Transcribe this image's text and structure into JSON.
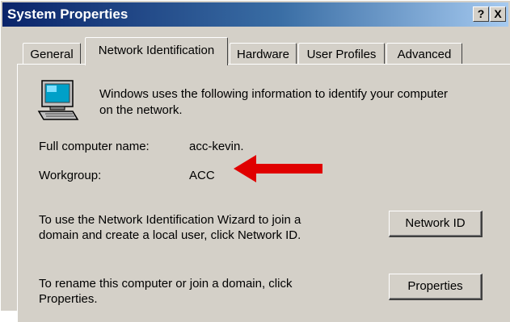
{
  "window": {
    "title": "System Properties",
    "help_label": "?",
    "close_label": "X"
  },
  "tabs": [
    {
      "label": "General",
      "selected": false
    },
    {
      "label": "Network Identification",
      "selected": true
    },
    {
      "label": "Hardware",
      "selected": false
    },
    {
      "label": "User Profiles",
      "selected": false
    },
    {
      "label": "Advanced",
      "selected": false
    }
  ],
  "info": {
    "line1": "Windows uses the following information to identify your computer",
    "line2": "on the network."
  },
  "full_name": {
    "label": "Full computer name:",
    "value": "acc-kevin."
  },
  "workgroup": {
    "label": "Workgroup:",
    "value": "ACC"
  },
  "network_id": {
    "line1": "To use the Network Identification Wizard to join a",
    "line2": "domain and create a local user, click Network ID.",
    "button_label": "Network ID"
  },
  "rename": {
    "line1": "To rename this computer or join a domain, click",
    "line2": "Properties.",
    "button_label": "Properties"
  },
  "annotation": {
    "arrow_color": "#e00000",
    "arrow_icon": "left-arrow-icon"
  },
  "colors": {
    "title_bar": "#0a246a",
    "face": "#d4d0c8"
  }
}
